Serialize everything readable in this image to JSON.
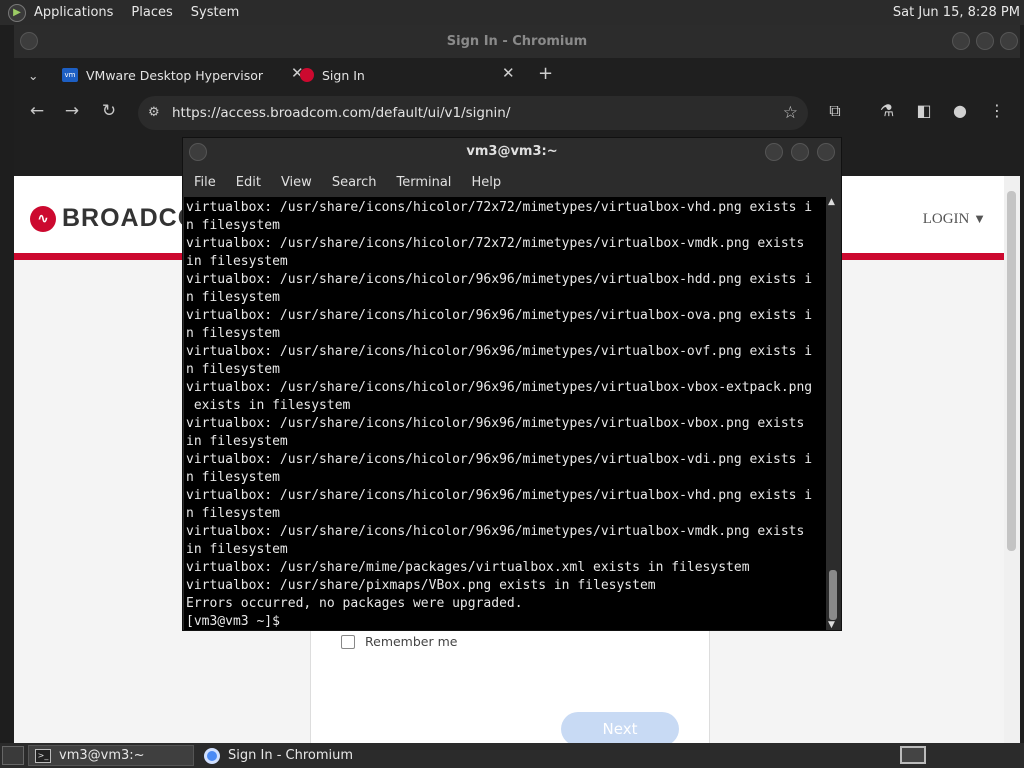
{
  "top_panel": {
    "menus": [
      "Applications",
      "Places",
      "System"
    ],
    "clock": "Sat Jun 15,  8:28 PM"
  },
  "chromium": {
    "title": "Sign In - Chromium",
    "tabs": [
      {
        "label": "VMware Desktop Hypervisor",
        "favicon": "vmware-icon"
      },
      {
        "label": "Sign In",
        "favicon": "broadcom-icon"
      }
    ],
    "url": "https://access.broadcom.com/default/ui/v1/signin/",
    "page": {
      "brand": "BROADCO",
      "login_label": "LOGIN",
      "remember_label": "Remember me",
      "next_label": "Next",
      "accent_color": "#cc092f"
    }
  },
  "terminal": {
    "title": "vm3@vm3:~",
    "menus": [
      "File",
      "Edit",
      "View",
      "Search",
      "Terminal",
      "Help"
    ],
    "lines": [
      "virtualbox: /usr/share/icons/hicolor/72x72/mimetypes/virtualbox-vhd.png exists i",
      "n filesystem",
      "virtualbox: /usr/share/icons/hicolor/72x72/mimetypes/virtualbox-vmdk.png exists",
      "in filesystem",
      "virtualbox: /usr/share/icons/hicolor/96x96/mimetypes/virtualbox-hdd.png exists i",
      "n filesystem",
      "virtualbox: /usr/share/icons/hicolor/96x96/mimetypes/virtualbox-ova.png exists i",
      "n filesystem",
      "virtualbox: /usr/share/icons/hicolor/96x96/mimetypes/virtualbox-ovf.png exists i",
      "n filesystem",
      "virtualbox: /usr/share/icons/hicolor/96x96/mimetypes/virtualbox-vbox-extpack.png",
      " exists in filesystem",
      "virtualbox: /usr/share/icons/hicolor/96x96/mimetypes/virtualbox-vbox.png exists",
      "in filesystem",
      "virtualbox: /usr/share/icons/hicolor/96x96/mimetypes/virtualbox-vdi.png exists i",
      "n filesystem",
      "virtualbox: /usr/share/icons/hicolor/96x96/mimetypes/virtualbox-vhd.png exists i",
      "n filesystem",
      "virtualbox: /usr/share/icons/hicolor/96x96/mimetypes/virtualbox-vmdk.png exists",
      "in filesystem",
      "virtualbox: /usr/share/mime/packages/virtualbox.xml exists in filesystem",
      "virtualbox: /usr/share/pixmaps/VBox.png exists in filesystem",
      "Errors occurred, no packages were upgraded.",
      "[vm3@vm3 ~]$ "
    ]
  },
  "taskbar": {
    "items": [
      {
        "label": "vm3@vm3:~",
        "icon": "terminal-icon"
      },
      {
        "label": "Sign In - Chromium",
        "icon": "chromium-icon"
      }
    ]
  }
}
